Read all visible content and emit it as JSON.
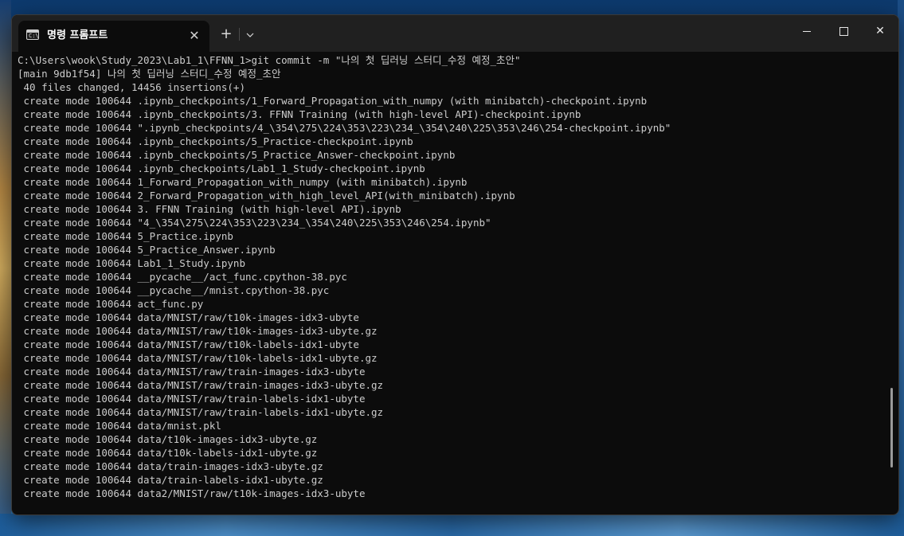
{
  "window": {
    "tab_title": "명령 프롬프트",
    "tab_icon": "cmd-icon",
    "new_tab_label": "+",
    "dropdown_icon": "chevron-down-icon",
    "close_tab_label": "✕",
    "close_window_label": "✕"
  },
  "terminal": {
    "lines": [
      "C:\\Users\\wook\\Study_2023\\Lab1_1\\FFNN_1>git commit -m \"나의 첫 딥러닝 스터디_수정 예정_초안\"",
      "[main 9db1f54] 나의 첫 딥러닝 스터디_수정 예정_초안",
      " 40 files changed, 14456 insertions(+)",
      " create mode 100644 .ipynb_checkpoints/1_Forward_Propagation_with_numpy (with minibatch)-checkpoint.ipynb",
      " create mode 100644 .ipynb_checkpoints/3. FFNN Training (with high-level API)-checkpoint.ipynb",
      " create mode 100644 \".ipynb_checkpoints/4_\\354\\275\\224\\353\\223\\234_\\354\\240\\225\\353\\246\\254-checkpoint.ipynb\"",
      " create mode 100644 .ipynb_checkpoints/5_Practice-checkpoint.ipynb",
      " create mode 100644 .ipynb_checkpoints/5_Practice_Answer-checkpoint.ipynb",
      " create mode 100644 .ipynb_checkpoints/Lab1_1_Study-checkpoint.ipynb",
      " create mode 100644 1_Forward_Propagation_with_numpy (with minibatch).ipynb",
      " create mode 100644 2_Forward_Propagation_with_high_level_API(with_minibatch).ipynb",
      " create mode 100644 3. FFNN Training (with high-level API).ipynb",
      " create mode 100644 \"4_\\354\\275\\224\\353\\223\\234_\\354\\240\\225\\353\\246\\254.ipynb\"",
      " create mode 100644 5_Practice.ipynb",
      " create mode 100644 5_Practice_Answer.ipynb",
      " create mode 100644 Lab1_1_Study.ipynb",
      " create mode 100644 __pycache__/act_func.cpython-38.pyc",
      " create mode 100644 __pycache__/mnist.cpython-38.pyc",
      " create mode 100644 act_func.py",
      " create mode 100644 data/MNIST/raw/t10k-images-idx3-ubyte",
      " create mode 100644 data/MNIST/raw/t10k-images-idx3-ubyte.gz",
      " create mode 100644 data/MNIST/raw/t10k-labels-idx1-ubyte",
      " create mode 100644 data/MNIST/raw/t10k-labels-idx1-ubyte.gz",
      " create mode 100644 data/MNIST/raw/train-images-idx3-ubyte",
      " create mode 100644 data/MNIST/raw/train-images-idx3-ubyte.gz",
      " create mode 100644 data/MNIST/raw/train-labels-idx1-ubyte",
      " create mode 100644 data/MNIST/raw/train-labels-idx1-ubyte.gz",
      " create mode 100644 data/mnist.pkl",
      " create mode 100644 data/t10k-images-idx3-ubyte.gz",
      " create mode 100644 data/t10k-labels-idx1-ubyte.gz",
      " create mode 100644 data/train-images-idx3-ubyte.gz",
      " create mode 100644 data/train-labels-idx1-ubyte.gz",
      " create mode 100644 data2/MNIST/raw/t10k-images-idx3-ubyte"
    ]
  },
  "colors": {
    "terminal_bg": "#0c0c0c",
    "terminal_fg": "#cccccc",
    "titlebar_bg": "#202020"
  }
}
